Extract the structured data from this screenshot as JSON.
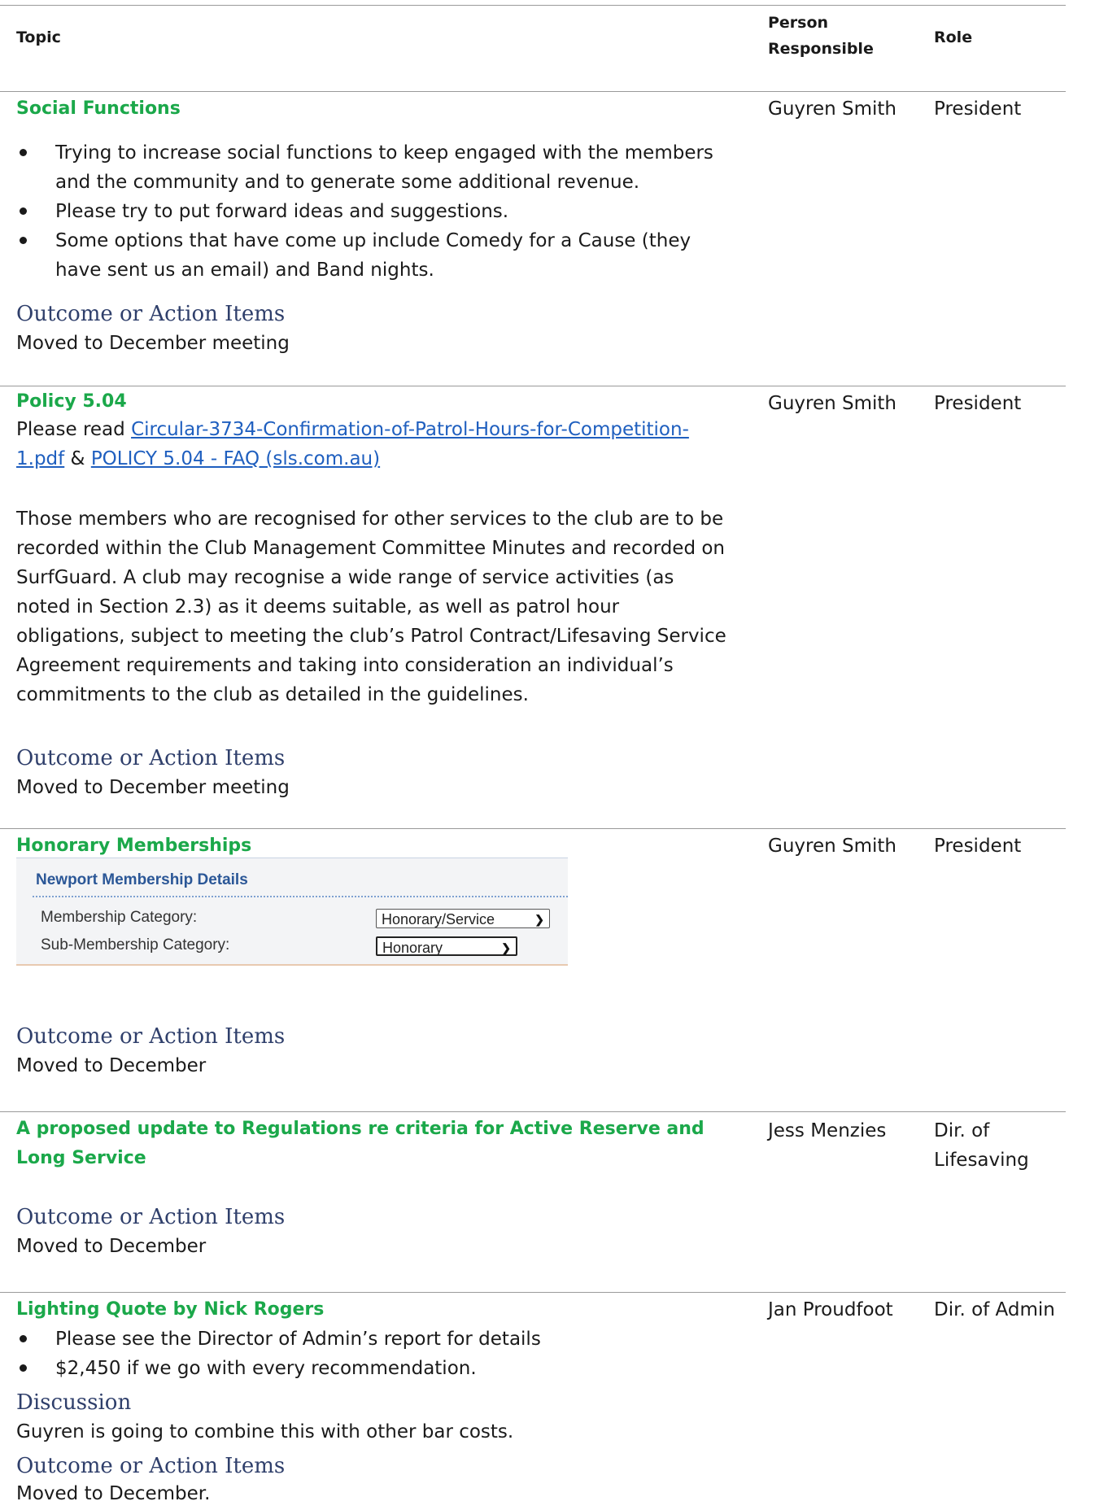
{
  "table_header": {
    "topic": "Topic",
    "person": "Person\nResponsible",
    "role": "Role"
  },
  "items": [
    {
      "title": "Social Functions",
      "person": "Guyren Smith",
      "role": "President",
      "bullets": [
        "Trying to increase social functions to keep engaged with the members and the community and to generate some additional revenue.",
        "Please try to put forward ideas and suggestions.",
        "Some options that have come up include Comedy for a Cause (they have sent us an email) and Band nights."
      ],
      "outcome_heading": "Outcome or Action Items",
      "outcome": "Moved to December meeting"
    },
    {
      "title": "Policy 5.04",
      "person": "Guyren Smith",
      "role": "President",
      "intro_prefix": "Please read ",
      "link1": "Circular-3734-Confirmation-of-Patrol-Hours-for-Competition-1.pdf",
      "intro_join": " & ",
      "link2": "POLICY 5.04 - FAQ (sls.com.au)",
      "paragraph": "Those members who are recognised for other services to the club are to be recorded within the Club Management Committee Minutes and recorded on SurfGuard. A club may recognise a wide range of service activities (as noted in Section 2.3) as it deems suitable, as well as patrol hour obligations, subject to meeting the club’s Patrol Contract/Lifesaving Service Agreement requirements and taking into consideration an individual’s commitments to the club as detailed in the guidelines.",
      "outcome_heading": "Outcome or Action Items",
      "outcome": "Moved to December meeting"
    },
    {
      "title": "Honorary Memberships",
      "person": "Guyren Smith",
      "role": "President",
      "panel": {
        "title": "Newport Membership Details",
        "category_label": "Membership Category:",
        "category_value": "Honorary/Service",
        "sub_label": "Sub-Membership Category:",
        "sub_value": "Honorary"
      },
      "outcome_heading": "Outcome or Action Items",
      "outcome": "Moved to December"
    },
    {
      "title": "A proposed update to Regulations re criteria for Active Reserve and Long Service",
      "person": "Jess Menzies",
      "role": "Dir. of\nLifesaving",
      "outcome_heading": "Outcome or Action Items",
      "outcome": "Moved to December"
    },
    {
      "title": "Lighting Quote by Nick Rogers",
      "person": "Jan Proudfoot",
      "role": "Dir. of Admin",
      "bullets": [
        "Please see the Director of Admin’s report for details",
        "$2,450 if we go with every recommendation."
      ],
      "discussion_heading": "Discussion",
      "discussion": "Guyren is going to combine this with other bar costs.",
      "outcome_heading": "Outcome or Action Items",
      "outcome": "Moved to December."
    }
  ]
}
